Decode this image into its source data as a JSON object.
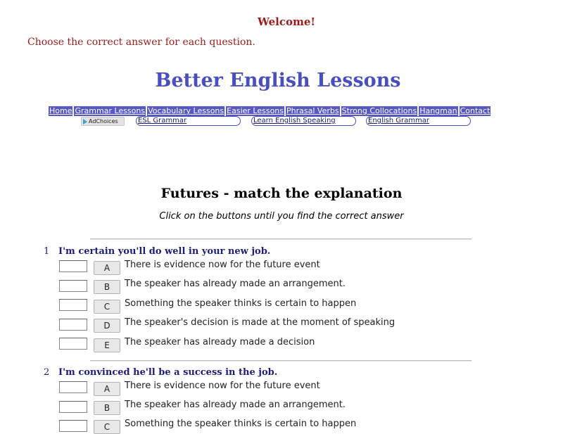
{
  "header": {
    "welcome": "Welcome!",
    "instruction": "Choose the correct answer for each question.",
    "site_title": "Better English Lessons"
  },
  "nav": {
    "items": [
      "Home",
      "Grammar Lessons",
      "Vocabulary Lessons",
      "Easier Lessons",
      "Phrasal Verbs",
      "Strong Collocations",
      "Hangman",
      "Contact"
    ]
  },
  "ads": {
    "adchoices_label": "AdChoices",
    "links": [
      "ESL Grammar",
      "Learn English Speaking",
      "English Grammar"
    ]
  },
  "quiz": {
    "title": "Futures - match the explanation",
    "subtitle": "Click on the buttons until you find the correct answer",
    "questions": [
      {
        "number": "1",
        "text": "I'm certain you'll do well in your new job.",
        "options": [
          {
            "letter": "A",
            "text": "There is evidence now for the future event"
          },
          {
            "letter": "B",
            "text": "The speaker has already made an arrangement."
          },
          {
            "letter": "C",
            "text": "Something the speaker thinks is certain to happen"
          },
          {
            "letter": "D",
            "text": "The speaker's decision is made at the moment of speaking"
          },
          {
            "letter": "E",
            "text": "The speaker has already made a decision"
          }
        ]
      },
      {
        "number": "2",
        "text": "I'm convinced he'll be a success in the job.",
        "options": [
          {
            "letter": "A",
            "text": "There is evidence now for the future event"
          },
          {
            "letter": "B",
            "text": "The speaker has already made an arrangement."
          },
          {
            "letter": "C",
            "text": "Something the speaker thinks is certain to happen"
          }
        ]
      }
    ]
  }
}
